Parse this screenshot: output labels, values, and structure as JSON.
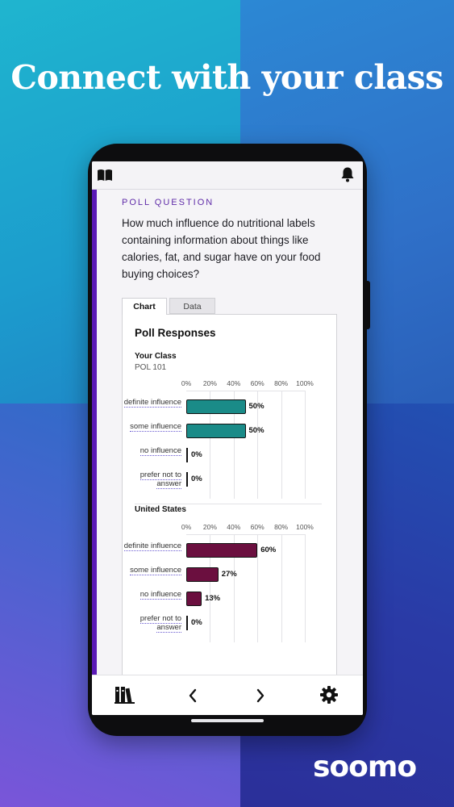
{
  "headline": "Connect with your class",
  "brand": "soomo",
  "poll": {
    "eyebrow": "POLL QUESTION",
    "question": "How much influence do nutritional labels containing information about things like calories, fat, and sugar have on your food buying choices?"
  },
  "tabs": [
    {
      "label": "Chart",
      "selected": true
    },
    {
      "label": "Data",
      "selected": false
    }
  ],
  "chart_data": [
    {
      "type": "bar",
      "orientation": "horizontal",
      "title": "Poll Responses",
      "group_title": "Your Class",
      "group_subtitle": "POL 101",
      "axis_ticks": [
        "0%",
        "20%",
        "40%",
        "60%",
        "80%",
        "100%"
      ],
      "xlim": [
        0,
        100
      ],
      "categories": [
        "definite influence",
        "some influence",
        "no influence",
        "prefer not to answer"
      ],
      "values": [
        50,
        50,
        0,
        0
      ],
      "value_labels": [
        "50%",
        "50%",
        "0%",
        "0%"
      ],
      "color": "#1a8b88"
    },
    {
      "type": "bar",
      "orientation": "horizontal",
      "group_title": "United States",
      "axis_ticks": [
        "0%",
        "20%",
        "40%",
        "60%",
        "80%",
        "100%"
      ],
      "xlim": [
        0,
        100
      ],
      "categories": [
        "definite influence",
        "some influence",
        "no influence",
        "prefer not to answer"
      ],
      "values": [
        60,
        27,
        13,
        0
      ],
      "value_labels": [
        "60%",
        "27%",
        "13%",
        "0%"
      ],
      "color": "#6b0f3f"
    }
  ],
  "icons": {
    "top_left": "book-icon",
    "top_right": "bell-icon",
    "nav": [
      "library-icon",
      "chevron-left-icon",
      "chevron-right-icon",
      "gear-icon"
    ]
  },
  "colors": {
    "accent": "#5a19b5",
    "teal": "#1a8b88",
    "maroon": "#6b0f3f"
  }
}
